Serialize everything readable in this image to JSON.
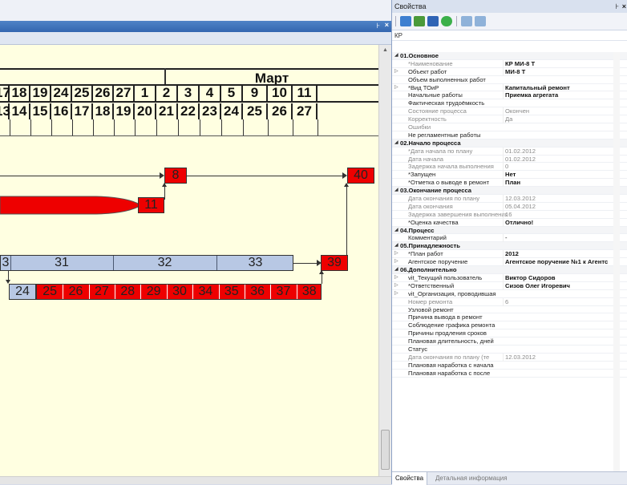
{
  "left_panel": {
    "pin_glyph": "⊦",
    "close_glyph": "×",
    "month": "Март",
    "row1": [
      "17",
      "18",
      "19",
      "24",
      "25",
      "26",
      "27",
      "1",
      "2",
      "3",
      "4",
      "5",
      "9",
      "10",
      "11"
    ],
    "row2": [
      "13",
      "14",
      "15",
      "16",
      "17",
      "18",
      "19",
      "20",
      "21",
      "22",
      "23",
      "24",
      "25",
      "26",
      "27"
    ]
  },
  "gantt": {
    "task_8": "8",
    "task_40": "40",
    "task_11": "11",
    "task_3": "3",
    "task_31": "31",
    "task_32": "32",
    "task_33": "33",
    "task_39": "39",
    "task_24": "24",
    "red_chain": [
      "25",
      "26",
      "27",
      "28",
      "29",
      "30",
      "34",
      "35",
      "36",
      "37",
      "38"
    ]
  },
  "properties": {
    "title": "Свойства",
    "pin_glyph": "⊦",
    "close_glyph": "×",
    "object": "КР",
    "rows": [
      {
        "type": "cat",
        "name": "01.Основное"
      },
      {
        "name": "*Наименование",
        "value": "КР  МИ-8 Т",
        "nameGray": true,
        "bold": true
      },
      {
        "name": "Объект работ",
        "value": "МИ-8 Т",
        "exp": "▷",
        "bold": true
      },
      {
        "name": "Объем выполненных работ",
        "value": ""
      },
      {
        "name": "*Вид ТОиР",
        "value": "Капитальный ремонт",
        "exp": "▷",
        "bold": true
      },
      {
        "name": "Начальные работы",
        "value": "Приемка агрегата",
        "bold": true
      },
      {
        "name": "Фактическая трудоёмкость",
        "value": ""
      },
      {
        "name": "Состояние процесса",
        "value": "Окончен",
        "nameGray": true,
        "valueGray": true
      },
      {
        "name": "Корректность",
        "value": "Да",
        "nameGray": true,
        "valueGray": true
      },
      {
        "name": "Ошибки",
        "value": "",
        "nameGray": true
      },
      {
        "name": "Не регламентные работы",
        "value": ""
      },
      {
        "type": "cat",
        "name": "02.Начало процесса"
      },
      {
        "name": "*Дата начала по плану",
        "value": "01.02.2012",
        "nameGray": true,
        "valueGray": true
      },
      {
        "name": "Дата начала",
        "value": "01.02.2012",
        "nameGray": true,
        "valueGray": true
      },
      {
        "name": "Задержка начала выполнения",
        "value": "0",
        "nameGray": true,
        "valueGray": true
      },
      {
        "name": "*Запущен",
        "value": "Нет",
        "bold": true
      },
      {
        "name": "*Отметка о выводе в ремонт",
        "value": "План",
        "bold": true
      },
      {
        "type": "cat",
        "name": "03.Окончание процесса"
      },
      {
        "name": "Дата окончания по плану",
        "value": "12.03.2012",
        "nameGray": true,
        "valueGray": true
      },
      {
        "name": "Дата окончания",
        "value": "05.04.2012",
        "nameGray": true,
        "valueGray": true
      },
      {
        "name": "Задержка завершения выполнения",
        "value": "16",
        "nameGray": true,
        "valueGray": true
      },
      {
        "name": "*Оценка качества",
        "value": "Отлично!",
        "bold": true
      },
      {
        "type": "cat",
        "name": "04.Процесс"
      },
      {
        "name": "Комментарий",
        "value": "-"
      },
      {
        "type": "cat",
        "name": "05.Принадлежность"
      },
      {
        "name": "*План работ",
        "value": "2012",
        "exp": "▷",
        "bold": true
      },
      {
        "name": "Агентское поручение",
        "value": "Агентское поручение №1 к Агентс",
        "exp": "▷",
        "bold": true
      },
      {
        "type": "cat",
        "name": "06.Дополнительно"
      },
      {
        "name": "vit_Текущий пользователь",
        "value": "Виктор Сидоров",
        "exp": "▷",
        "bold": true
      },
      {
        "name": "*Ответственный",
        "value": "Сизов Олег Игоревич",
        "exp": "▷",
        "bold": true
      },
      {
        "name": "vit_Организация, проводившая",
        "value": "",
        "exp": "▷"
      },
      {
        "name": "Номер ремонта",
        "value": "   6",
        "nameGray": true,
        "valueGray": true
      },
      {
        "name": "Узловой ремонт",
        "value": ""
      },
      {
        "name": "Причина вывода в ремонт",
        "value": ""
      },
      {
        "name": "Соблюдение графика ремонта",
        "value": ""
      },
      {
        "name": "Причины продления сроков",
        "value": ""
      },
      {
        "name": "Плановая длительность, дней",
        "value": ""
      },
      {
        "name": "Статус",
        "value": ""
      },
      {
        "name": "Дата окончания по плану (те",
        "value": "12.03.2012",
        "nameGray": true,
        "valueGray": true
      },
      {
        "name": "Плановая наработка с начала",
        "value": ""
      },
      {
        "name": "Плановая наработка с после",
        "value": ""
      }
    ],
    "tabs": [
      "Свойства",
      "Детальная информация"
    ]
  }
}
